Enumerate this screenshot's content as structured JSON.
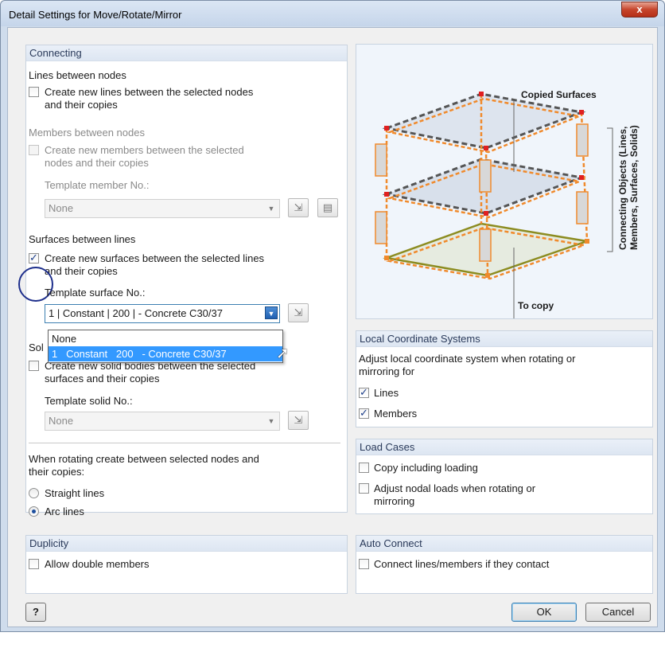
{
  "window": {
    "title": "Detail Settings for Move/Rotate/Mirror",
    "close_symbol": "x"
  },
  "connecting": {
    "header": "Connecting",
    "lines": {
      "heading": "Lines between nodes",
      "checkbox_label_1": "Create new lines between the selected nodes",
      "checkbox_label_2": "and their copies",
      "checked": false
    },
    "members": {
      "heading": "Members between nodes",
      "checkbox_label_1": "Create new members between the selected",
      "checkbox_label_2": "nodes and their copies",
      "checked": false,
      "template_label": "Template member No.:",
      "template_value": "None"
    },
    "surfaces": {
      "heading": "Surfaces between lines",
      "checkbox_label_1": "Create new surfaces between the selected lines",
      "checkbox_label_2": "and their copies",
      "checked": true,
      "template_label": "Template surface No.:",
      "template_value": "1 | Constant | 200 | - Concrete C30/37",
      "options": [
        "None",
        "1   Constant   200   - Concrete C30/37"
      ],
      "selected_option": "1   Constant   200   - Concrete C30/37"
    },
    "solids": {
      "heading_partial": "Sol",
      "checkbox_label_1": "Create new solid bodies between the selected",
      "checkbox_label_2": "surfaces and their copies",
      "checked": false,
      "template_label": "Template solid No.:",
      "template_value": "None"
    },
    "rotating": {
      "heading_1": "When rotating create between selected nodes and",
      "heading_2": "their copies:",
      "options": [
        "Straight lines",
        "Arc lines"
      ],
      "selected": "Arc lines"
    }
  },
  "diagram": {
    "label_top": "Copied Surfaces",
    "label_side_1": "Connecting Objects (Lines,",
    "label_side_2": "Members, Surfaces, Solids)",
    "label_bottom": "To copy"
  },
  "local_coordinate_systems": {
    "header": "Local Coordinate Systems",
    "description_1": "Adjust local coordinate system when rotating or",
    "description_2": "mirroring for",
    "lines_label": "Lines",
    "lines_checked": true,
    "members_label": "Members",
    "members_checked": true
  },
  "load_cases": {
    "header": "Load Cases",
    "copy_loading_label": "Copy including loading",
    "adjust_label_1": "Adjust nodal loads when rotating or",
    "adjust_label_2": "mirroring"
  },
  "duplicity": {
    "header": "Duplicity",
    "allow_double_label": "Allow double members"
  },
  "auto_connect": {
    "header": "Auto Connect",
    "connect_label": "Connect lines/members if they contact"
  },
  "buttons": {
    "help_symbol": "?",
    "ok": "OK",
    "cancel": "Cancel"
  },
  "colors": {
    "accent": "#3399ff",
    "group_header_text": "#2a3a5a",
    "diagram_orange": "#f08a2c",
    "highlight_ring": "#1e2f8c"
  }
}
